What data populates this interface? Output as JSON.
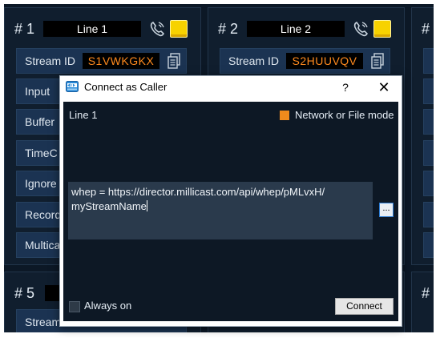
{
  "panels": [
    {
      "number": "# 1",
      "name": "Line 1",
      "stream_id_label": "Stream ID",
      "stream_id": "S1VWKGKX"
    },
    {
      "number": "# 2",
      "name": "Line 2",
      "stream_id_label": "Stream ID",
      "stream_id": "S2HUUVQV"
    },
    {
      "number": "# 5",
      "stream_id_label": "Stream"
    }
  ],
  "panel1_rows": [
    "Input",
    "Buffer",
    "TimeC",
    "Ignore",
    "Record",
    "Multicas"
  ],
  "bg_panel_prefix": "#",
  "dialog": {
    "title": "Connect as Caller",
    "help": "?",
    "close": "✕",
    "line_label": "Line 1",
    "mode_label": "Network or File mode",
    "url_value": "whep = https://director.millicast.com/api/whep/pMLvxH/\nmyStreamName",
    "browse_label": "...",
    "always_on_label": "Always on",
    "connect_label": "Connect"
  },
  "colors": {
    "accent_orange": "#f08a1c",
    "led_yellow": "#f7d200",
    "stream_id_text": "#ff8a1e"
  }
}
